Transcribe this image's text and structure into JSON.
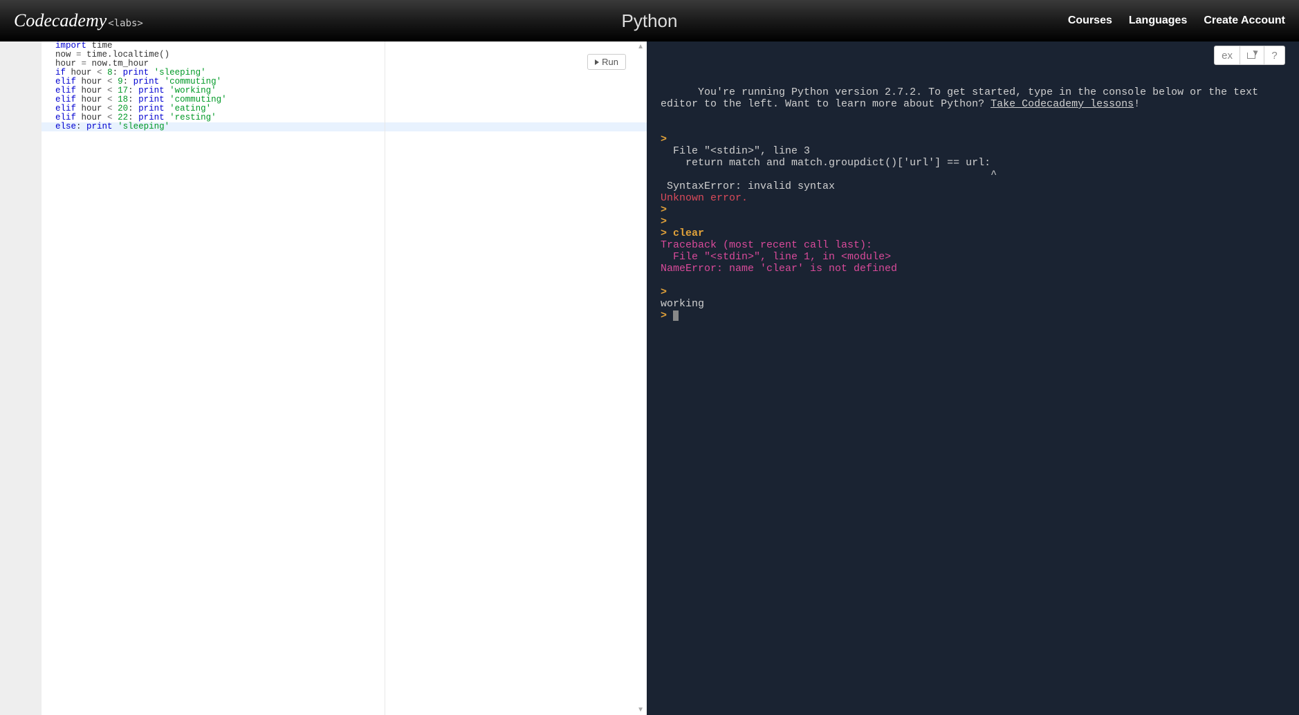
{
  "header": {
    "logo_main": "Codecademy",
    "logo_labs": "<labs>",
    "title": "Python",
    "nav": {
      "courses": "Courses",
      "languages": "Languages",
      "create_account": "Create Account"
    }
  },
  "editor": {
    "run_label": "Run",
    "code_lines": [
      [
        [
          "kw",
          "import"
        ],
        [
          "var",
          " time"
        ]
      ],
      [
        [
          "var",
          "now "
        ],
        [
          "op",
          "="
        ],
        [
          "var",
          " time"
        ],
        [
          "punc",
          "."
        ],
        [
          "var",
          "localtime"
        ],
        [
          "punc",
          "()"
        ]
      ],
      [
        [
          "var",
          "hour "
        ],
        [
          "op",
          "="
        ],
        [
          "var",
          " now"
        ],
        [
          "punc",
          "."
        ],
        [
          "var",
          "tm_hour"
        ]
      ],
      [
        [
          "kw",
          "if"
        ],
        [
          "var",
          " hour "
        ],
        [
          "op",
          "<"
        ],
        [
          "var",
          " "
        ],
        [
          "num",
          "8"
        ],
        [
          "punc",
          ":"
        ],
        [
          "var",
          " "
        ],
        [
          "kw",
          "print"
        ],
        [
          "var",
          " "
        ],
        [
          "str",
          "'sleeping'"
        ]
      ],
      [
        [
          "kw",
          "elif"
        ],
        [
          "var",
          " hour "
        ],
        [
          "op",
          "<"
        ],
        [
          "var",
          " "
        ],
        [
          "num",
          "9"
        ],
        [
          "punc",
          ":"
        ],
        [
          "var",
          " "
        ],
        [
          "kw",
          "print"
        ],
        [
          "var",
          " "
        ],
        [
          "str",
          "'commuting'"
        ]
      ],
      [
        [
          "kw",
          "elif"
        ],
        [
          "var",
          " hour "
        ],
        [
          "op",
          "<"
        ],
        [
          "var",
          " "
        ],
        [
          "num",
          "17"
        ],
        [
          "punc",
          ":"
        ],
        [
          "var",
          " "
        ],
        [
          "kw",
          "print"
        ],
        [
          "var",
          " "
        ],
        [
          "str",
          "'working'"
        ]
      ],
      [
        [
          "kw",
          "elif"
        ],
        [
          "var",
          " hour "
        ],
        [
          "op",
          "<"
        ],
        [
          "var",
          " "
        ],
        [
          "num",
          "18"
        ],
        [
          "punc",
          ":"
        ],
        [
          "var",
          " "
        ],
        [
          "kw",
          "print"
        ],
        [
          "var",
          " "
        ],
        [
          "str",
          "'commuting'"
        ]
      ],
      [
        [
          "kw",
          "elif"
        ],
        [
          "var",
          " hour "
        ],
        [
          "op",
          "<"
        ],
        [
          "var",
          " "
        ],
        [
          "num",
          "20"
        ],
        [
          "punc",
          ":"
        ],
        [
          "var",
          " "
        ],
        [
          "kw",
          "print"
        ],
        [
          "var",
          " "
        ],
        [
          "str",
          "'eating'"
        ]
      ],
      [
        [
          "kw",
          "elif"
        ],
        [
          "var",
          " hour "
        ],
        [
          "op",
          "<"
        ],
        [
          "var",
          " "
        ],
        [
          "num",
          "22"
        ],
        [
          "punc",
          ":"
        ],
        [
          "var",
          " "
        ],
        [
          "kw",
          "print"
        ],
        [
          "var",
          " "
        ],
        [
          "str",
          "'resting'"
        ]
      ],
      [
        [
          "kw",
          "else"
        ],
        [
          "punc",
          ":"
        ],
        [
          "var",
          " "
        ],
        [
          "kw",
          "print"
        ],
        [
          "var",
          " "
        ],
        [
          "str",
          "'sleeping'"
        ]
      ]
    ],
    "highlighted_line_index": 9
  },
  "toolbar": {
    "ex_label": "ex",
    "help_label": "?"
  },
  "console": {
    "intro_part1": "You're running Python version 2.7.2. To get started, type in the console below or the text editor to the left. Want to learn more about Python? ",
    "intro_link": "Take Codecademy lessons",
    "intro_part2": "!",
    "lines": [
      {
        "type": "blank"
      },
      {
        "type": "prompt"
      },
      {
        "type": "out",
        "text": "  File \"<stdin>\", line 3"
      },
      {
        "type": "out",
        "text": "    return match and match.groupdict()['url'] == url:"
      },
      {
        "type": "out",
        "text": "                                                     ^"
      },
      {
        "type": "out",
        "text": " SyntaxError: invalid syntax"
      },
      {
        "type": "err-red",
        "text": "Unknown error."
      },
      {
        "type": "prompt"
      },
      {
        "type": "prompt"
      },
      {
        "type": "prompt-cmd",
        "cmd": "clear"
      },
      {
        "type": "err-mag",
        "text": "Traceback (most recent call last):"
      },
      {
        "type": "err-mag",
        "text": "  File \"<stdin>\", line 1, in <module>"
      },
      {
        "type": "err-mag",
        "text": "NameError: name 'clear' is not defined"
      },
      {
        "type": "blank"
      },
      {
        "type": "prompt"
      },
      {
        "type": "out",
        "text": "working"
      },
      {
        "type": "prompt-cursor"
      }
    ]
  }
}
